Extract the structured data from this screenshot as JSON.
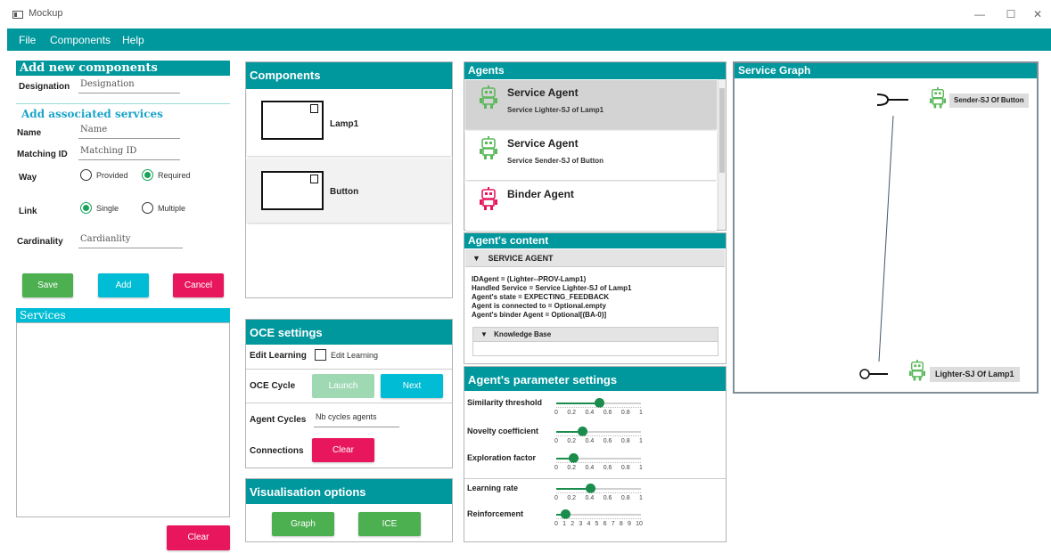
{
  "window": {
    "title": "Mockup",
    "minimize": "—",
    "maximize": "☐",
    "close": "✕"
  },
  "menu": [
    "File",
    "Components",
    "Help"
  ],
  "add_components": {
    "header": "Add new components",
    "designation_label": "Designation",
    "designation_placeholder": "Designation",
    "services_header": "Add associated services",
    "name_label": "Name",
    "name_placeholder": "Name",
    "matching_label": "Matching ID",
    "matching_placeholder": "Matching ID",
    "way_label": "Way",
    "way_options": [
      "Provided",
      "Required"
    ],
    "way_selected": "Required",
    "link_label": "Link",
    "link_options": [
      "Single",
      "Multiple"
    ],
    "link_selected": "Single",
    "cardinality_label": "Cardinality",
    "cardinality_placeholder": "Cardianlity",
    "save": "Save",
    "add": "Add",
    "cancel": "Cancel"
  },
  "services": {
    "header": "Services",
    "clear": "Clear"
  },
  "components": {
    "header": "Components",
    "items": [
      "Lamp1",
      "Button"
    ]
  },
  "oce": {
    "header": "OCE settings",
    "edit_learning_label": "Edit Learning",
    "edit_learning_checkbox": "Edit Learning",
    "cycle_label": "OCE Cycle",
    "launch": "Launch",
    "next": "Next",
    "agent_cycles_label": "Agent Cycles",
    "agent_cycles_placeholder": "Nb cycles agents",
    "connections_label": "Connections",
    "clear": "Clear"
  },
  "visualisation": {
    "header": "Visualisation options",
    "graph": "Graph",
    "ice": "ICE"
  },
  "agents": {
    "header": "Agents",
    "items": [
      {
        "title": "Service Agent",
        "subtitle": "Service Lighter-SJ of Lamp1",
        "color": "#5cb85c",
        "selected": true
      },
      {
        "title": "Service Agent",
        "subtitle": "Service Sender-SJ of Button",
        "color": "#5cb85c",
        "selected": false
      },
      {
        "title": "Binder Agent",
        "subtitle": "",
        "color": "#e8175d",
        "selected": false
      }
    ]
  },
  "agent_content": {
    "header": "Agent's content",
    "section": "SERVICE AGENT",
    "lines": [
      "IDAgent = (Lighter--PROV-Lamp1)",
      "Handled Service  = Service Lighter-SJ of Lamp1",
      "Agent's state  = EXPECTING_FEEDBACK",
      "Agent is connected to  = Optional.empty",
      "Agent's binder Agent  = Optional[(BA-0)]"
    ],
    "knowledge": "Knowledge Base"
  },
  "params": {
    "header": "Agent's parameter settings",
    "sliders": [
      {
        "label": "Similarity threshold",
        "value": 0.5,
        "max": 1,
        "ticks": [
          "0",
          "0.2",
          "0.4",
          "0.6",
          "0.8",
          "1"
        ]
      },
      {
        "label": "Novelty coefficient",
        "value": 0.3,
        "max": 1,
        "ticks": [
          "0",
          "0.2",
          "0.4",
          "0.6",
          "0.8",
          "1"
        ]
      },
      {
        "label": "Exploration factor",
        "value": 0.2,
        "max": 1,
        "ticks": [
          "0",
          "0.2",
          "0.4",
          "0.6",
          "0.8",
          "1"
        ]
      },
      {
        "label": "Learning rate",
        "value": 0.4,
        "max": 1,
        "ticks": [
          "0",
          "0.2",
          "0.4",
          "0.6",
          "0.8",
          "1"
        ]
      },
      {
        "label": "Reinforcement",
        "value": 1,
        "max": 10,
        "ticks": [
          "0",
          "1",
          "2",
          "3",
          "4",
          "5",
          "6",
          "7",
          "8",
          "9",
          "10"
        ]
      }
    ]
  },
  "graph": {
    "header": "Service Graph",
    "nodes": [
      "Sender-SJ Of Button",
      "Lighter-SJ Of Lamp1"
    ]
  }
}
